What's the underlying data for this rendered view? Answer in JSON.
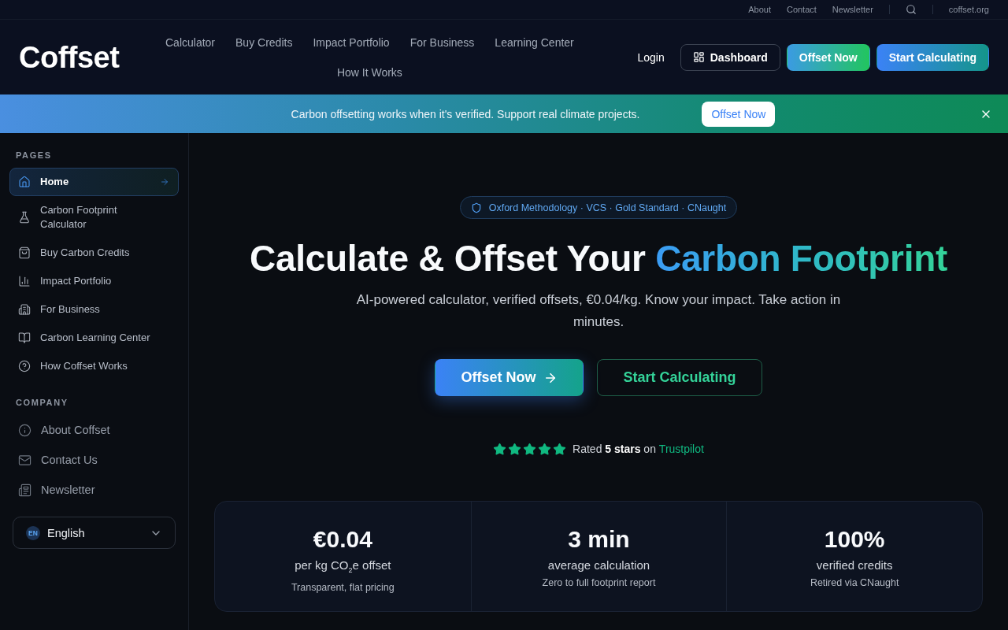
{
  "utility_bar": {
    "links": [
      "About",
      "Contact",
      "Newsletter"
    ],
    "domain": "coffset.org"
  },
  "header": {
    "logo": "Coffset",
    "nav": [
      "Calculator",
      "Buy Credits",
      "Impact Portfolio",
      "For Business",
      "Learning Center",
      "How It Works"
    ],
    "login": "Login",
    "buttons": [
      {
        "label": "Dashboard",
        "kind": "outline"
      },
      {
        "label": "Offset Now",
        "kind": "green"
      },
      {
        "label": "Start Calculating",
        "kind": "blue"
      }
    ]
  },
  "banner": {
    "message": "Carbon offsetting works when it's verified. Support real climate projects.",
    "button": "Offset Now"
  },
  "sidebar": {
    "sections": [
      {
        "heading": "PAGES",
        "kind": "primary",
        "items": [
          {
            "label": "Home",
            "selected": true
          },
          {
            "label": "Carbon Footprint Calculator",
            "selected": false
          },
          {
            "label": "Buy Carbon Credits",
            "selected": false
          },
          {
            "label": "Impact Portfolio",
            "selected": false
          },
          {
            "label": "For Business",
            "selected": false
          },
          {
            "label": "Carbon Learning Center",
            "selected": false
          },
          {
            "label": "How Coffset Works",
            "selected": false
          }
        ]
      },
      {
        "heading": "COMPANY",
        "kind": "secondary",
        "items": [
          {
            "label": "About Coffset",
            "selected": false
          },
          {
            "label": "Contact Us",
            "selected": false
          },
          {
            "label": "Newsletter",
            "selected": false
          }
        ]
      }
    ],
    "language": {
      "code": "EN",
      "label": "English"
    }
  },
  "hero": {
    "badge": "Oxford Methodology · VCS · Gold Standard · CNaught",
    "title": "Calculate & Offset Your",
    "title_highlight": "Carbon Footprint",
    "subtitle": "AI-powered calculator, verified offsets, €0.04/kg. Know your impact. Take action in minutes.",
    "buttons": [
      {
        "label": "Offset Now",
        "kind": "primary"
      },
      {
        "label": "Start Calculating",
        "kind": "outline"
      }
    ],
    "rating": {
      "stars": 5,
      "text": "Rated **5 stars** on",
      "link": "Trustpilot"
    }
  },
  "stats": [
    {
      "value": "€0.04",
      "label": "per kg CO$_{2}$e offset",
      "note": "Transparent, flat pricing"
    },
    {
      "value": "3 min",
      "label": "average calculation",
      "note": "Zero to full footprint report"
    },
    {
      "value": "100%",
      "label": "verified credits",
      "note": "Retired via CNaught"
    }
  ]
}
